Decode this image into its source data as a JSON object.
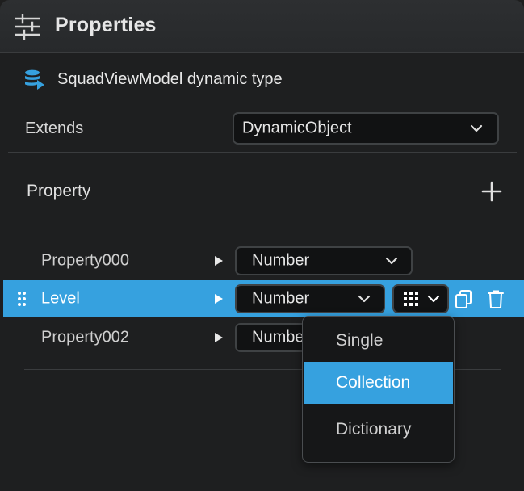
{
  "header": {
    "title": "Properties",
    "icon": "sliders-icon"
  },
  "type_info": {
    "icon": "database-icon",
    "title": "SquadViewModel dynamic type"
  },
  "extends": {
    "label": "Extends",
    "value": "DynamicObject"
  },
  "property_section": {
    "label": "Property",
    "add_icon": "plus-icon"
  },
  "properties": [
    {
      "name": "Property000",
      "type": "Number",
      "selected": false
    },
    {
      "name": "Level",
      "type": "Number",
      "selected": true,
      "container_icon": "grid-icon"
    },
    {
      "name": "Property002",
      "type": "Number",
      "selected": false
    }
  ],
  "container_menu": {
    "items": [
      "Single",
      "Collection",
      "Dictionary"
    ],
    "highlighted": "Collection"
  },
  "colors": {
    "accent": "#36a1df",
    "panel_bg": "#1e1f20",
    "header_bg": "#2b2d2f",
    "field_bg": "#111213"
  }
}
